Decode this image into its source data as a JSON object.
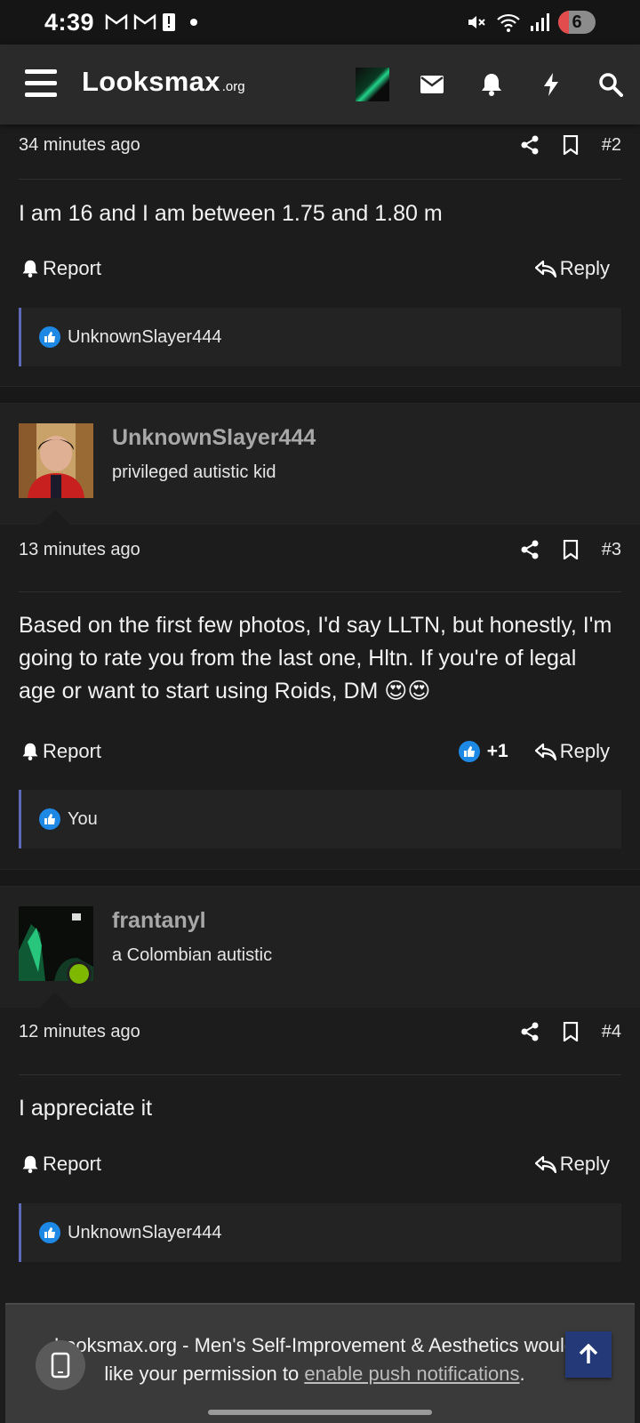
{
  "status_bar": {
    "time": "4:39",
    "battery": "6"
  },
  "top_bar": {
    "logo_main": "Looksmax",
    "logo_tld": ".org"
  },
  "posts": [
    {
      "time_ago": "34 minutes ago",
      "number": "#2",
      "message": "I am 16 and I am between 1.75 and 1.80 m",
      "report_label": "Report",
      "reply_label": "Reply",
      "liked_by": "UnknownSlayer444"
    },
    {
      "author": "UnknownSlayer444",
      "author_title": "privileged autistic kid",
      "time_ago": "13 minutes ago",
      "number": "#3",
      "message": "Based on the first few photos, I'd say LLTN, but honestly, I'm going to rate you from the last one, Hltn. If you're of legal age or want to start using Roids, DM 😍😍",
      "report_label": "Report",
      "reaction_count": "+1",
      "reply_label": "Reply",
      "liked_by": "You"
    },
    {
      "author": "frantanyl",
      "author_title": "a Colombian autistic",
      "time_ago": "12 minutes ago",
      "number": "#4",
      "message": "I appreciate it",
      "report_label": "Report",
      "reply_label": "Reply",
      "liked_by": "UnknownSlayer444"
    }
  ],
  "push_banner": {
    "text": "Looksmax.org - Men's Self-Improvement & Aesthetics would like your permission to ",
    "link": "enable push notifications",
    "suffix": "."
  },
  "colors": {
    "background": "#1c1c1c",
    "accent_border": "#5e6ab8",
    "like_blue": "#1e88e5",
    "online_green": "#7fb800"
  }
}
